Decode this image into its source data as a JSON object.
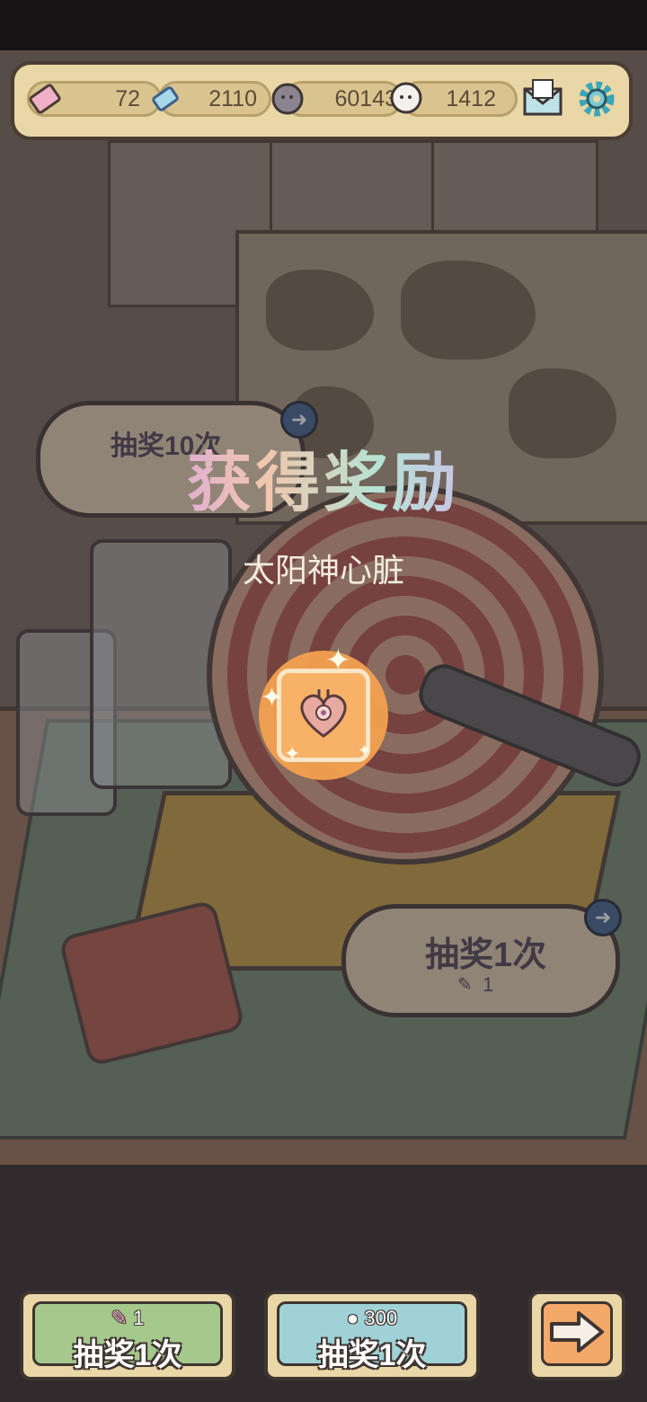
{
  "resources": {
    "tickets": "72",
    "gems": "2110",
    "coins": "60143",
    "souls": "1412"
  },
  "icons": {
    "ticket": "ticket-icon",
    "gem": "gem-icon",
    "coin": "bubble-currency-icon",
    "soul": "ghost-currency-icon",
    "mail": "mail-icon",
    "settings": "gear-icon"
  },
  "reward": {
    "title": "获得奖励",
    "item_name": "太阳神心脏"
  },
  "bubbles": {
    "ten_draw_label": "抽奖10次",
    "single_draw_label": "抽奖1次",
    "single_draw_cost": "1"
  },
  "buttons": {
    "ticket_draw_cost": "1",
    "ticket_draw_label": "抽奖1次",
    "coin_draw_cost": "300",
    "coin_draw_label": "抽奖1次"
  },
  "colors": {
    "green_button": "#a5c88d",
    "blue_button": "#9fd1d6",
    "orange_button": "#f2a96a",
    "reward_glow": "#f3a14f"
  }
}
